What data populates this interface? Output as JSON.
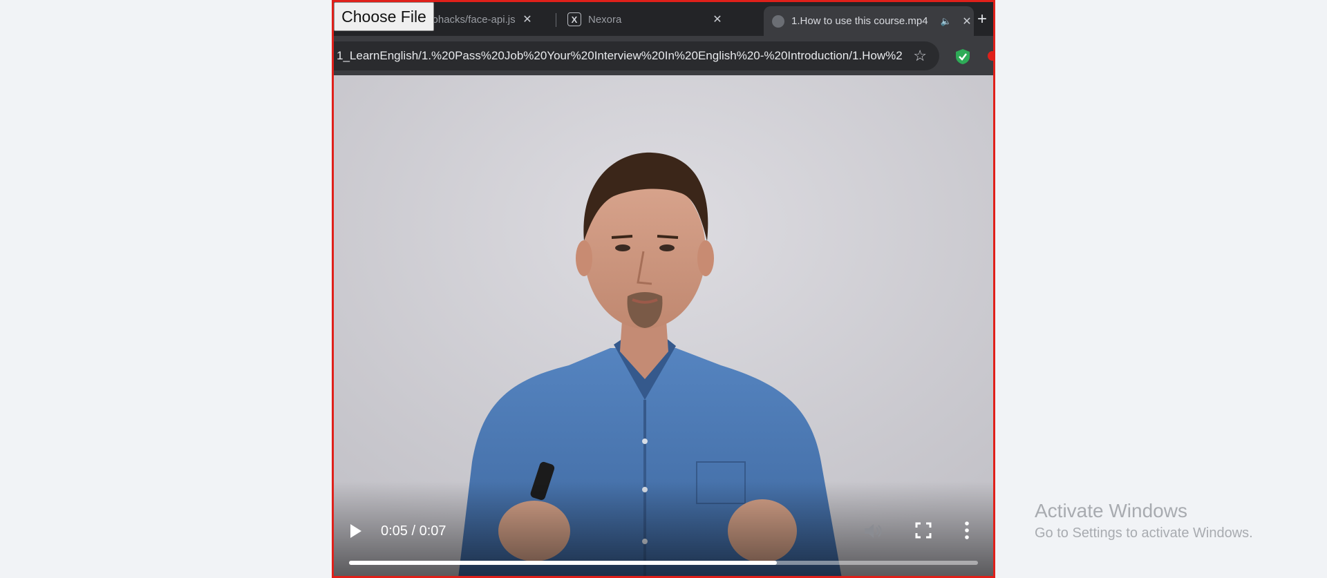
{
  "browser": {
    "tabs": [
      {
        "title": "/hohacks/face-api.js"
      },
      {
        "title": "Nexora"
      },
      {
        "title": "1.How to use this course.mp4"
      }
    ],
    "new_tab_label": "+",
    "close_label": "✕",
    "url": "1_LearnEnglish/1.%20Pass%20Job%20Your%20Interview%20In%20English%20-%20Introduction/1.How%2...",
    "star_label": "☆",
    "x_logo": "X"
  },
  "file_input": {
    "label": "Choose File"
  },
  "player": {
    "time_display": "0:05 / 0:07",
    "progress_fraction": 0.68,
    "muted_icon": "speaker-muted-icon"
  },
  "watermark": {
    "title": "Activate Windows",
    "subtitle": "Go to Settings to activate Windows."
  },
  "colors": {
    "frame_border": "#e0201a",
    "shirt": "#4a76b0",
    "background": "#f1f3f6"
  }
}
